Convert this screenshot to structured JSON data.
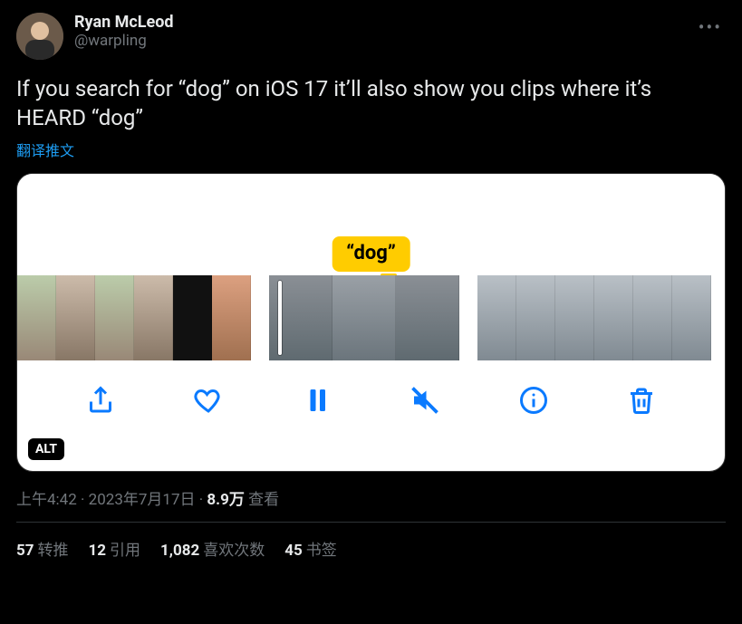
{
  "author": {
    "display_name": "Ryan McLeod",
    "handle": "@warpling"
  },
  "tweet_text": "If you search for “dog” on iOS 17 it’ll also show you clips where it’s HEARD “dog”",
  "translate_label": "翻译推文",
  "media": {
    "caption_pill": "“dog”",
    "alt_badge": "ALT",
    "toolbar": {
      "share": "share-icon",
      "like": "heart-icon",
      "pause": "pause-icon",
      "mute": "mute-icon",
      "info": "info-icon",
      "delete": "trash-icon"
    }
  },
  "meta": {
    "time": "上午4:42",
    "date": "2023年7月17日",
    "views_count": "8.9万",
    "views_label": "查看",
    "sep": " · "
  },
  "stats": {
    "retweets": {
      "count": "57",
      "label": "转推"
    },
    "quotes": {
      "count": "12",
      "label": "引用"
    },
    "likes": {
      "count": "1,082",
      "label": "喜欢次数"
    },
    "bookmarks": {
      "count": "45",
      "label": "书签"
    }
  }
}
